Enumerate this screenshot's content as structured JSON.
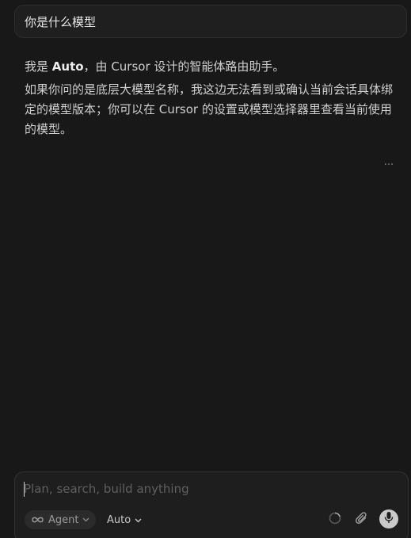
{
  "user_message": {
    "text": "你是什么模型"
  },
  "assistant": {
    "para1_prefix": "我是 ",
    "para1_bold": "Auto",
    "para1_suffix": "，由 Cursor 设计的智能体路由助手。",
    "para2": "如果你问的是底层大模型名称，我这边无法看到或确认当前会话具体绑定的模型版本；你可以在 Cursor 的设置或模型选择器里查看当前使用的模型。",
    "more_label": "···"
  },
  "composer": {
    "placeholder": "Plan, search, build anything",
    "value": "",
    "mode_label": "Agent",
    "model_label": "Auto"
  },
  "icons": {
    "mode": "infinity-icon",
    "mode_chevron": "chevron-down-icon",
    "model_chevron": "chevron-down-icon",
    "context": "loading-spinner-icon",
    "attach": "paperclip-icon",
    "voice": "microphone-icon",
    "more": "ellipsis-icon"
  },
  "colors": {
    "background": "#181818",
    "bubble": "#1f1f1f",
    "text": "#cfcfcf",
    "pill": "#2b2b2b",
    "mic_button": "#c9c9c9"
  }
}
